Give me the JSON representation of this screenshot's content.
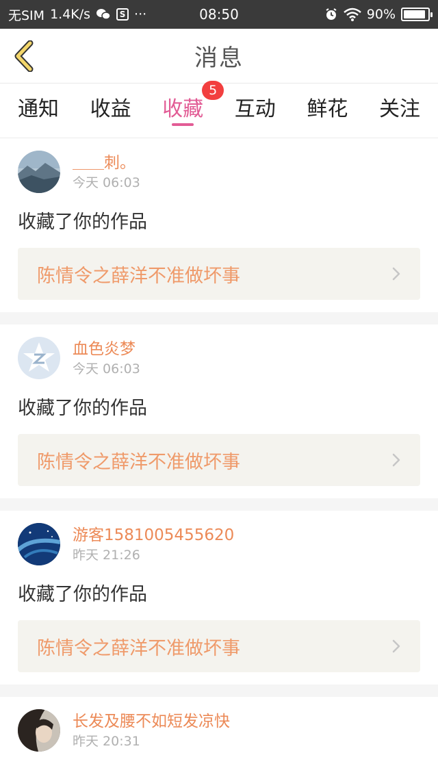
{
  "status_bar": {
    "carrier": "无SIM",
    "speed": "1.4K/s",
    "sb_icon_letter": "S",
    "dots": "···",
    "time": "08:50",
    "battery_text": "90%",
    "battery_level": 0.9
  },
  "header": {
    "title": "消息"
  },
  "tabs": [
    {
      "label": "通知"
    },
    {
      "label": "收益"
    },
    {
      "label": "收藏",
      "badge": "5"
    },
    {
      "label": "互动"
    },
    {
      "label": "鲜花"
    },
    {
      "label": "关注"
    }
  ],
  "messages": [
    {
      "username": "＿＿刺。",
      "time": "今天 06:03",
      "action": "收藏了你的作品",
      "work_title": "陈情令之薛洋不准做坏事",
      "avatar_icon": "mountain-landscape-avatar"
    },
    {
      "username": "血色炎梦",
      "time": "今天 06:03",
      "action": "收藏了你的作品",
      "work_title": "陈情令之薛洋不准做坏事",
      "avatar_icon": "default-z-avatar"
    },
    {
      "username": "游客1581005455620",
      "time": "昨天 21:26",
      "action": "收藏了你的作品",
      "work_title": "陈情令之薛洋不准做坏事",
      "avatar_icon": "galaxy-avatar"
    },
    {
      "username": "长发及腰不如短发凉快",
      "time": "昨天 20:31",
      "action": "",
      "work_title": "",
      "avatar_icon": "portrait-avatar"
    }
  ],
  "colors": {
    "accent_pink": "#e25c95",
    "username_orange": "#ec8a57",
    "badge_red": "#f23f3f"
  }
}
